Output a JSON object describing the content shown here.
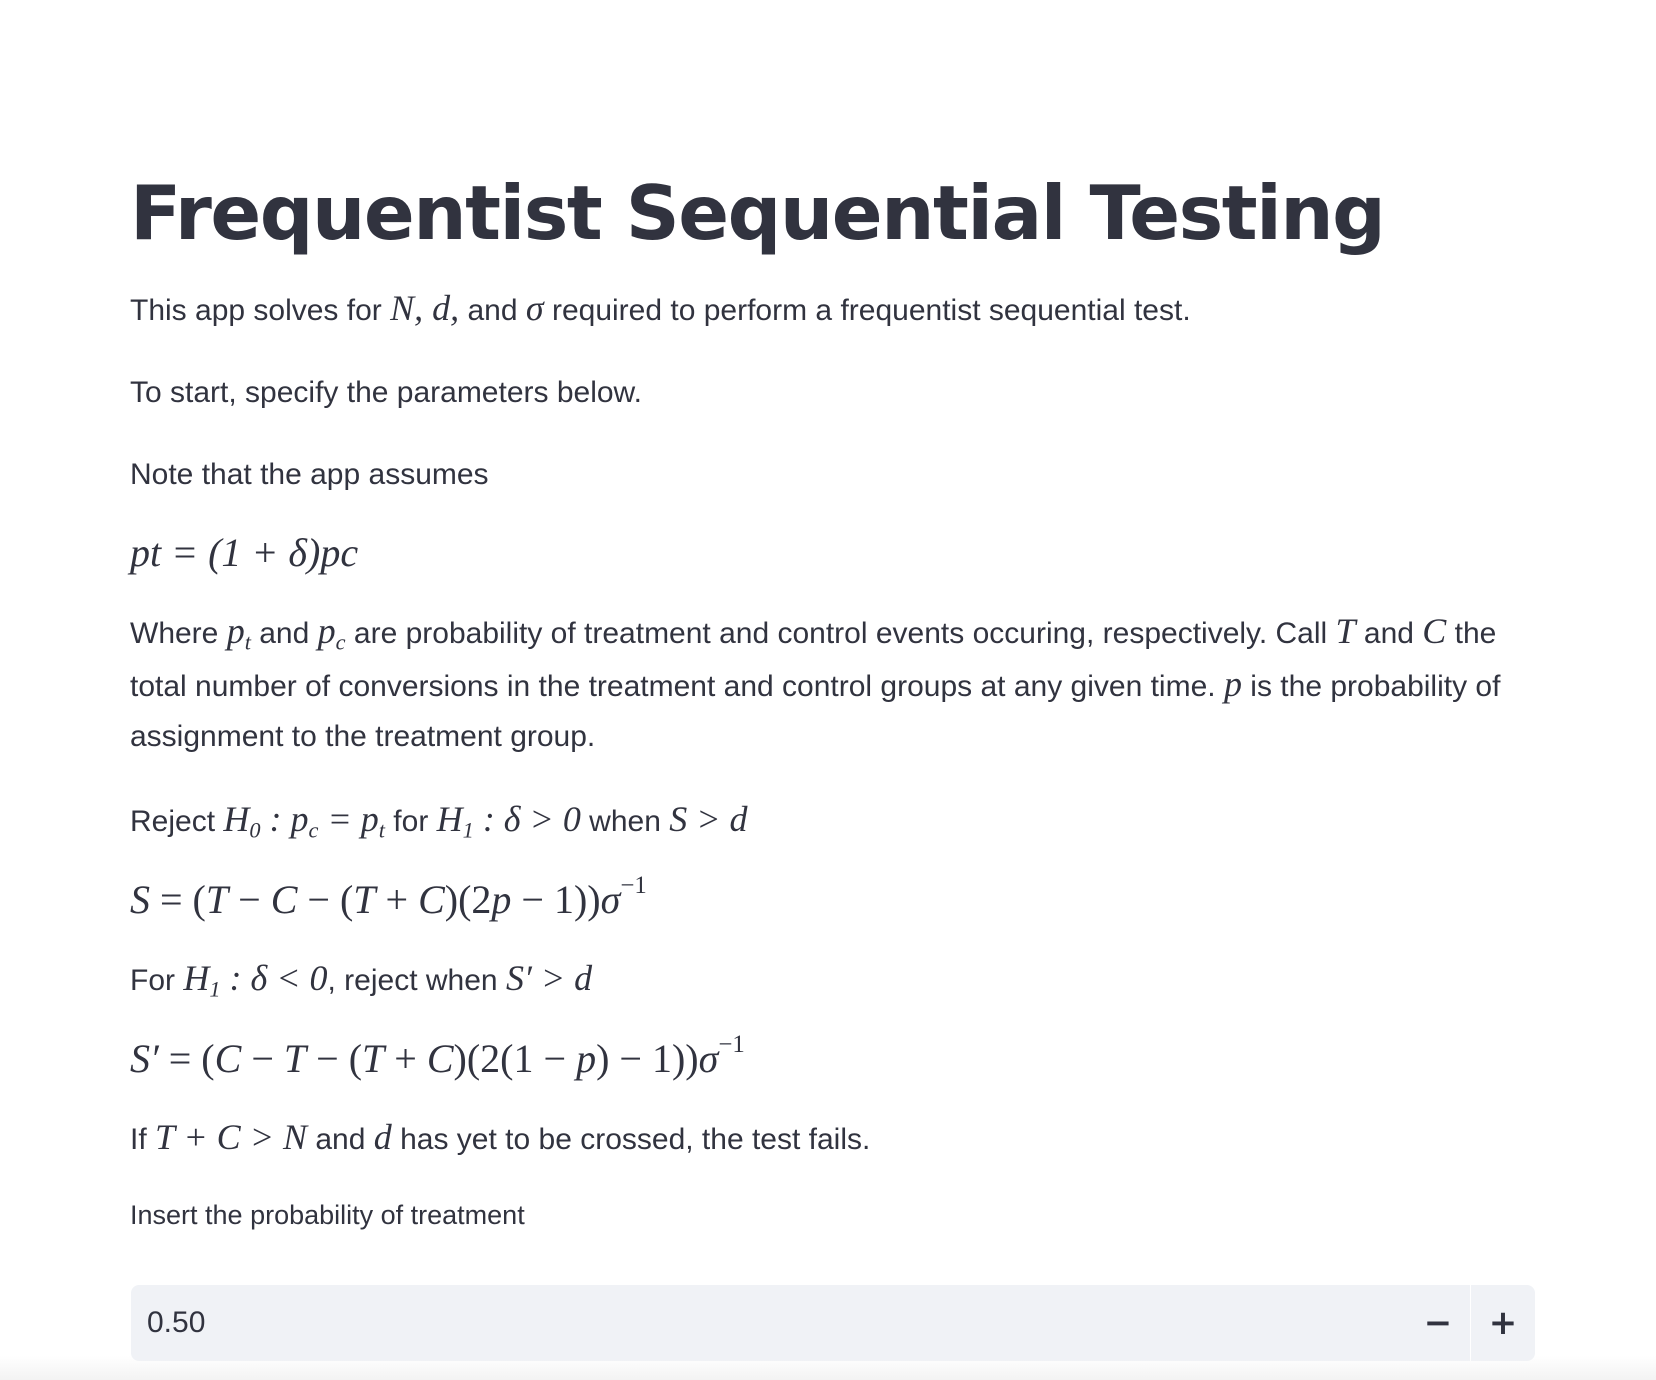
{
  "page": {
    "title": "Frequentist Sequential Testing"
  },
  "intro": {
    "p1_a": "This app solves for ",
    "p1_vars": "N, d,",
    "p1_b": " and ",
    "p1_sigma": "σ",
    "p1_c": " required to perform a frequentist sequential test.",
    "p2": "To start, specify the parameters below.",
    "p3": "Note that the app assumes"
  },
  "equations": {
    "assumption": "pt = (1 + δ)pc",
    "s_stat": "S = (T − C − (T + C)(2p − 1))σ⁻¹",
    "s_prime_stat": "S′ = (C − T − (T + C)(2(1 − p) − 1))σ⁻¹"
  },
  "explanation": {
    "where": "Where",
    "and1": "and",
    "probs": "are probability of treatment and control events occuring, respectively. Call",
    "and2": "and",
    "totals": "the total number of conversions in the treatment and control groups at any given time.",
    "p_def": "is the probability of assignment to the treatment group."
  },
  "reject": {
    "reject_word": "Reject",
    "for_word": "for",
    "when_word": "when"
  },
  "alt": {
    "for_word": "For",
    "reject_when": ", reject when"
  },
  "fail": {
    "if_word": "If",
    "and_word": "and",
    "rest": "has yet to be crossed, the test fails."
  },
  "input": {
    "label": "Insert the probability of treatment",
    "value": "0.50",
    "decrement": "−",
    "increment": "+"
  }
}
